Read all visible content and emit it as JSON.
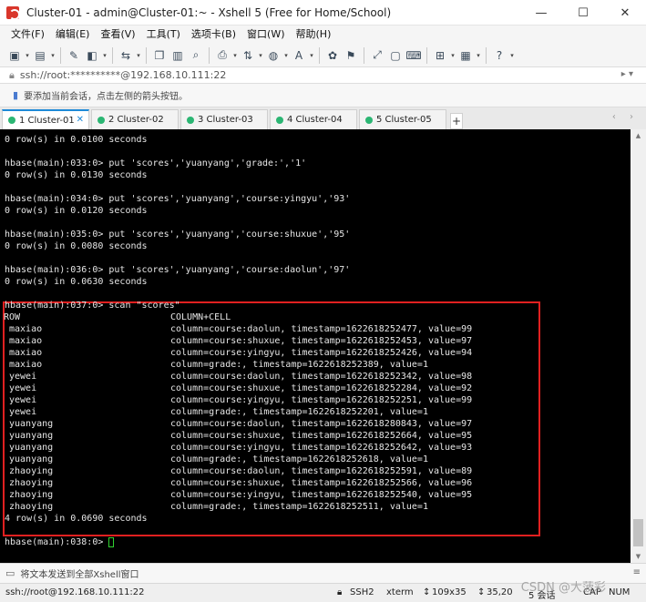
{
  "window": {
    "title": "Cluster-01 - admin@Cluster-01:~ - Xshell 5 (Free for Home/School)",
    "controls": [
      "—",
      "☐",
      "✕"
    ]
  },
  "menu": [
    "文件(F)",
    "编辑(E)",
    "查看(V)",
    "工具(T)",
    "选项卡(B)",
    "窗口(W)",
    "帮助(H)"
  ],
  "address": {
    "text": "ssh://root:**********@192.168.10.111:22",
    "right": "▸ ▾"
  },
  "hint": {
    "text": "要添加当前会话，点击左侧的箭头按钮。"
  },
  "tabs": [
    {
      "label": "1 Cluster-01",
      "active": true
    },
    {
      "label": "2 Cluster-02",
      "active": false
    },
    {
      "label": "3 Cluster-03",
      "active": false
    },
    {
      "label": "4 Cluster-04",
      "active": false
    },
    {
      "label": "5 Cluster-05",
      "active": false
    }
  ],
  "tab_add": "+",
  "tab_nav": "‹ ›",
  "terminal": {
    "lines_before": [
      "0 row(s) in 0.0100 seconds",
      "",
      "hbase(main):033:0> put 'scores','yuanyang','grade:','1'",
      "0 row(s) in 0.0130 seconds",
      "",
      "hbase(main):034:0> put 'scores','yuanyang','course:yingyu','93'",
      "0 row(s) in 0.0120 seconds",
      "",
      "hbase(main):035:0> put 'scores','yuanyang','course:shuxue','95'",
      "0 row(s) in 0.0080 seconds",
      "",
      "hbase(main):036:0> put 'scores','yuanyang','course:daolun','97'",
      "0 row(s) in 0.0630 seconds",
      "",
      "hbase(main):037:0> scan \"scores\""
    ],
    "scan_header": {
      "row": "ROW",
      "cell": "COLUMN+CELL"
    },
    "scan_rows": [
      {
        "row": "maxiao",
        "cell": "column=course:daolun, timestamp=1622618252477, value=99"
      },
      {
        "row": "maxiao",
        "cell": "column=course:shuxue, timestamp=1622618252453, value=97"
      },
      {
        "row": "maxiao",
        "cell": "column=course:yingyu, timestamp=1622618252426, value=94"
      },
      {
        "row": "maxiao",
        "cell": "column=grade:, timestamp=1622618252389, value=1"
      },
      {
        "row": "yewei",
        "cell": "column=course:daolun, timestamp=1622618252342, value=98"
      },
      {
        "row": "yewei",
        "cell": "column=course:shuxue, timestamp=1622618252284, value=92"
      },
      {
        "row": "yewei",
        "cell": "column=course:yingyu, timestamp=1622618252251, value=99"
      },
      {
        "row": "yewei",
        "cell": "column=grade:, timestamp=1622618252201, value=1"
      },
      {
        "row": "yuanyang",
        "cell": "column=course:daolun, timestamp=1622618280843, value=97"
      },
      {
        "row": "yuanyang",
        "cell": "column=course:shuxue, timestamp=1622618252664, value=95"
      },
      {
        "row": "yuanyang",
        "cell": "column=course:yingyu, timestamp=1622618252642, value=93"
      },
      {
        "row": "yuanyang",
        "cell": "column=grade:, timestamp=1622618252618, value=1"
      },
      {
        "row": "zhaoying",
        "cell": "column=course:daolun, timestamp=1622618252591, value=89"
      },
      {
        "row": "zhaoying",
        "cell": "column=course:shuxue, timestamp=1622618252566, value=96"
      },
      {
        "row": "zhaoying",
        "cell": "column=course:yingyu, timestamp=1622618252540, value=95"
      },
      {
        "row": "zhaoying",
        "cell": "column=grade:, timestamp=1622618252511, value=1"
      }
    ],
    "scan_summary": "4 row(s) in 0.0690 seconds",
    "prompt": "hbase(main):038:0> ",
    "text_color": "#e6e6e6",
    "highlight_color": "#e02020",
    "cursor_color": "#2fd12f"
  },
  "sendbar": {
    "text": "将文本发送到全部Xshell窗口",
    "right": "≡"
  },
  "status": {
    "address": "ssh://root@192.168.10.111:22",
    "protocol": "SSH2",
    "term": "xterm",
    "size": "109x35",
    "pos": "35,20",
    "sessions": "5 会话",
    "caps": "CAP",
    "num": "NUM"
  },
  "watermark": "CSDN @大菠彩",
  "accent": "#1e8ad8"
}
